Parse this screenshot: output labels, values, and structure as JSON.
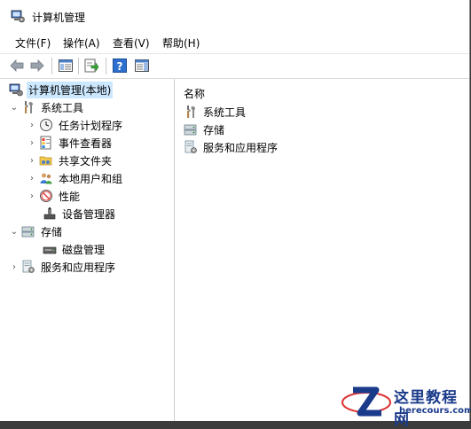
{
  "window": {
    "title": "计算机管理"
  },
  "menu": [
    {
      "label": "文件(F)"
    },
    {
      "label": "操作(A)"
    },
    {
      "label": "查看(V)"
    },
    {
      "label": "帮助(H)"
    }
  ],
  "tree": {
    "root": "计算机管理(本地)",
    "system_tools": "系统工具",
    "task_scheduler": "任务计划程序",
    "event_viewer": "事件查看器",
    "shared_folders": "共享文件夹",
    "local_users": "本地用户和组",
    "performance": "性能",
    "device_manager": "设备管理器",
    "storage": "存储",
    "disk_management": "磁盘管理",
    "services_apps": "服务和应用程序"
  },
  "content": {
    "column_header": "名称",
    "items": [
      "系统工具",
      "存储",
      "服务和应用程序"
    ]
  },
  "watermark": {
    "title": "这里教程网",
    "url": "herecours.com"
  }
}
